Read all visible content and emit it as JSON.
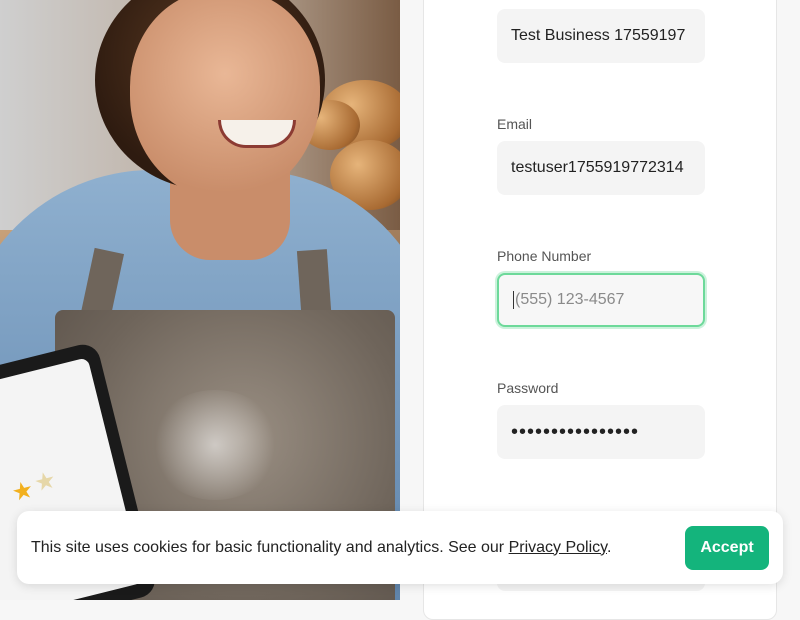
{
  "hero": {
    "image_description_icon": "photo-baker-with-tablet"
  },
  "form": {
    "business_name": {
      "value": "Test Business 17559197"
    },
    "email": {
      "label": "Email",
      "value": "testuser1755919772314"
    },
    "phone": {
      "label": "Phone Number",
      "placeholder": "(555) 123-4567"
    },
    "password": {
      "label": "Password",
      "masked_value": "••••••••••••••••"
    }
  },
  "cookie_banner": {
    "text": "This site uses cookies for basic functionality and analytics. See our ",
    "link": "Privacy Policy",
    "text_end": ".",
    "accept_label": "Accept"
  },
  "colors": {
    "accent": "#14b47c",
    "focus_ring": "#6dd99a"
  }
}
